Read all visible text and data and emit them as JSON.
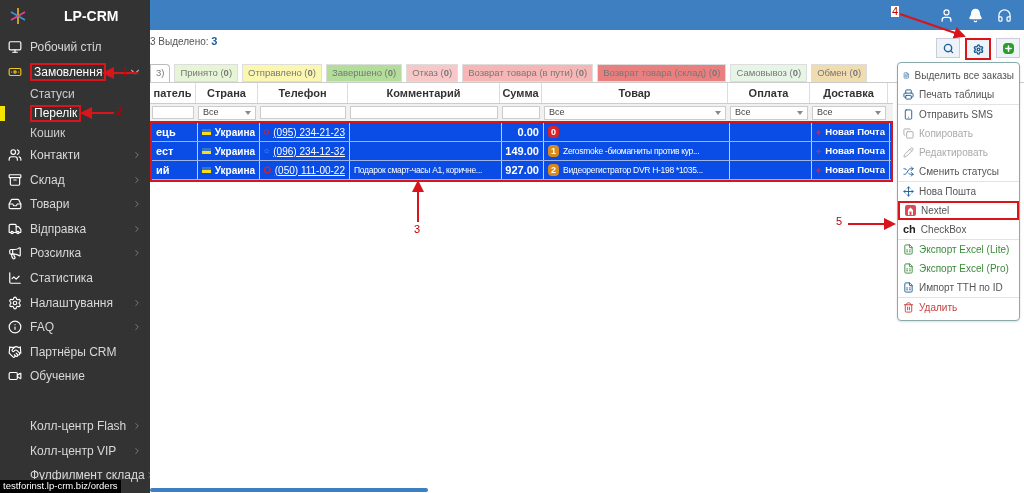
{
  "sidebar": {
    "logo": "LP-CRM",
    "items": [
      {
        "label": "Робочий стіл",
        "expandable": false,
        "annotated": false
      },
      {
        "label": "Замовлення",
        "expandable": true,
        "expanded": true,
        "annotated": true,
        "children": [
          {
            "label": "Статуси",
            "selected": false,
            "annotated": false
          },
          {
            "label": "Перелік",
            "selected": true,
            "annotated": true
          },
          {
            "label": "Кошик",
            "selected": false,
            "annotated": false
          }
        ]
      },
      {
        "label": "Контакти",
        "expandable": true,
        "annotated": false
      },
      {
        "label": "Склад",
        "expandable": true,
        "annotated": false
      },
      {
        "label": "Товари",
        "expandable": true,
        "annotated": false
      },
      {
        "label": "Відправка",
        "expandable": true,
        "annotated": false
      },
      {
        "label": "Розсилка",
        "expandable": true,
        "annotated": false
      },
      {
        "label": "Статистика",
        "expandable": false,
        "annotated": false
      },
      {
        "label": "Налаштування",
        "expandable": true,
        "annotated": false
      },
      {
        "label": "FAQ",
        "expandable": true,
        "annotated": false
      },
      {
        "label": "Партнёры CRM",
        "expandable": false,
        "annotated": false
      },
      {
        "label": "Обучение",
        "expandable": false,
        "annotated": false
      }
    ],
    "bottom_items": [
      {
        "label": "Колл-центр Flash",
        "expandable": true
      },
      {
        "label": "Колл-центр VIP",
        "expandable": true
      },
      {
        "label": "Фулфилмент склада",
        "expandable": true
      }
    ]
  },
  "summary": {
    "total": "3",
    "selected_label": "Выделено:",
    "selected_count": "3"
  },
  "tabs": [
    {
      "label": "3)",
      "color": "#ffffff",
      "selected": true
    },
    {
      "label": "Принято (**0**)",
      "color": "#e6f5d6",
      "selected": false
    },
    {
      "label": "Отправлено (**0**)",
      "color": "#fbf7b0",
      "selected": false
    },
    {
      "label": "Завершено (**0**)",
      "color": "#b3dd9a",
      "selected": false
    },
    {
      "label": "Отказ (**0**)",
      "color": "#f8c8c8",
      "selected": false
    },
    {
      "label": "Возврат товара (в пути) (**0**)",
      "color": "#f6b6b6",
      "selected": false
    },
    {
      "label": "Возврат товара (склад) (**0**)",
      "color": "#ea7f7f",
      "selected": false
    },
    {
      "label": "Самовывоз (**0**)",
      "color": "#e6f5e6",
      "selected": false
    },
    {
      "label": "Обмен (**0**)",
      "color": "#f1dcb0",
      "selected": false
    }
  ],
  "table": {
    "columns": [
      "патель",
      "Страна",
      "Телефон",
      "Комментарий",
      "Сумма",
      "Товар",
      "Оплата",
      "Доставка"
    ],
    "filters": {
      "country": "Все",
      "product": "Все",
      "payment": "Все",
      "delivery": "Все"
    },
    "annotated": true,
    "rows": [
      {
        "selected": true,
        "customer": "ець",
        "country": "Украина",
        "phone": "(095) 234-21-23",
        "comment": "",
        "sum": "0.00",
        "product_badge": {
          "count": "0",
          "color": "#d9232a"
        },
        "product": "",
        "delivery": "Новая Почта"
      },
      {
        "selected": true,
        "customer": "ест",
        "country": "Украина",
        "phone": "(096) 234-12-32",
        "comment": "",
        "sum": "149.00",
        "product_badge": {
          "count": "1",
          "color": "#d98a1c"
        },
        "product": "Zerosmoke -биомагниты против кур...",
        "delivery": "Новая Почта"
      },
      {
        "selected": true,
        "customer": "ий",
        "country": "Украина",
        "phone": "(050) 111-00-22",
        "comment": "Подарок смарт-часы А1, коричне...",
        "sum": "927.00",
        "product_badge": {
          "count": "2",
          "color": "#d98a1c"
        },
        "product": "Видеорегистратор DVR H-198 *1035...",
        "delivery": "Новая Почта"
      }
    ]
  },
  "toolbar": {
    "settings_annotated": true
  },
  "menu": {
    "sections": [
      [
        {
          "label": "Выделить все заказы",
          "kind": "normal",
          "annotated": false
        },
        {
          "label": "Печать таблицы",
          "kind": "normal",
          "annotated": false
        }
      ],
      [
        {
          "label": "Отправить SMS",
          "kind": "normal",
          "annotated": false
        },
        {
          "label": "Копировать",
          "kind": "disabled",
          "annotated": false
        },
        {
          "label": "Редактировать",
          "kind": "disabled",
          "annotated": false
        },
        {
          "label": "Сменить статусы",
          "kind": "normal",
          "annotated": false
        }
      ],
      [
        {
          "label": "Нова Пошта",
          "kind": "normal",
          "annotated": false
        },
        {
          "label": "Nextel",
          "kind": "normal",
          "annotated": true
        },
        {
          "label": "CheckBox",
          "kind": "normal",
          "annotated": false,
          "prefix": "ch"
        }
      ],
      [
        {
          "label": "Экспорт Excel (Lite)",
          "kind": "export",
          "annotated": false
        },
        {
          "label": "Экспорт Excel (Pro)",
          "kind": "export",
          "annotated": false
        },
        {
          "label": "Импорт ТТН по ID",
          "kind": "import",
          "annotated": false
        }
      ],
      [
        {
          "label": "Удалить",
          "kind": "danger",
          "annotated": false
        }
      ]
    ]
  },
  "annotations": [
    {
      "label": "1"
    },
    {
      "label": "2"
    },
    {
      "label": "3"
    },
    {
      "label": "4"
    },
    {
      "label": "5"
    }
  ],
  "status_bar": {
    "url": "testforinst.lp-crm.biz/orders"
  }
}
